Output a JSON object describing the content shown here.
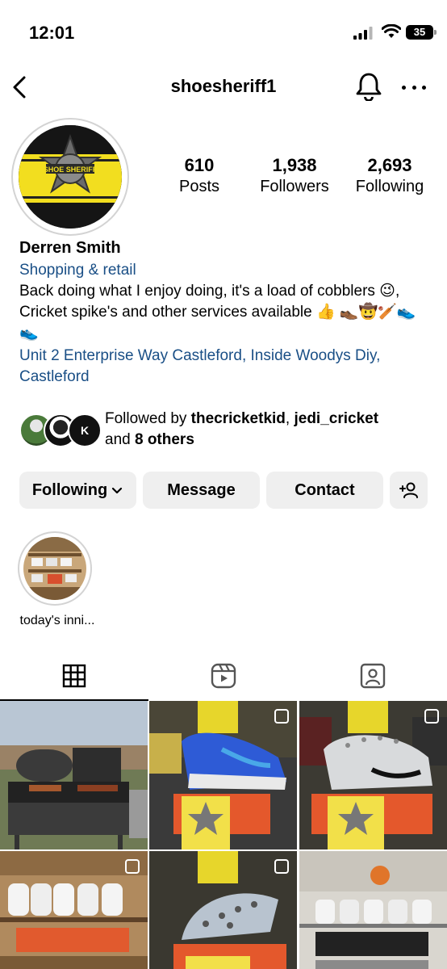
{
  "status": {
    "time": "12:01",
    "battery": "35"
  },
  "nav": {
    "username": "shoesheriff1"
  },
  "profile": {
    "avatar_text": "SHOE SHERIFF",
    "stats": [
      {
        "value": "610",
        "label": "Posts"
      },
      {
        "value": "1,938",
        "label": "Followers"
      },
      {
        "value": "2,693",
        "label": "Following"
      }
    ],
    "name": "Derren Smith",
    "category": "Shopping & retail",
    "bio": "Back doing what I enjoy doing, it's a load of cobblers 😉, Cricket spike's and other services available 👍 👞🤠🏏👟👟",
    "address": "Unit 2 Enterprise Way Castleford, Inside Woodys Diy, Castleford"
  },
  "followed_by": {
    "prefix": "Followed by ",
    "user1": "thecricketkid",
    "separator": ", ",
    "user2": "jedi_cricket",
    "conjunction": "and ",
    "others": "8 others"
  },
  "buttons": {
    "following": "Following",
    "message": "Message",
    "contact": "Contact"
  },
  "highlights": [
    {
      "label": "today's inni..."
    }
  ],
  "colors": {
    "link": "#1a4f86",
    "button_bg": "#efefef",
    "ring": "#d3d3d3"
  }
}
